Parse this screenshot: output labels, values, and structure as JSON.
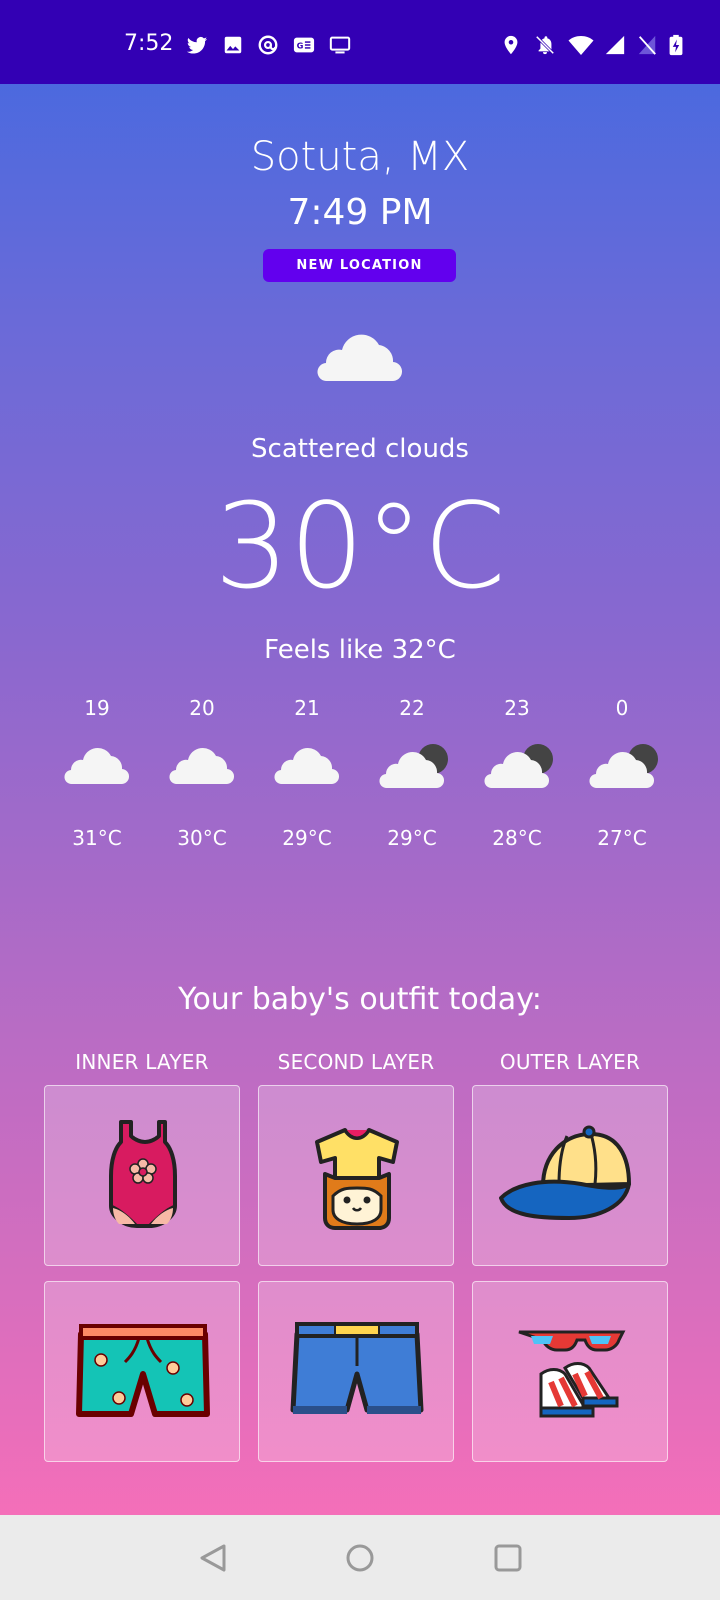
{
  "status_bar": {
    "time": "7:52",
    "left_icons": [
      "twitter-icon",
      "image-icon",
      "at-sign-icon",
      "translate-icon",
      "monitor-icon"
    ],
    "right_icons": [
      "location-icon",
      "notifications-off-icon",
      "wifi-icon",
      "signal-icon",
      "no-sim-icon",
      "battery-charging-icon"
    ]
  },
  "header": {
    "city": "Sotuta, MX",
    "time": "7:49 PM",
    "new_location_label": "NEW LOCATION"
  },
  "current": {
    "icon": "cloud-icon",
    "description": "Scattered clouds",
    "temperature": "30°C",
    "feels_like": "Feels like 32°C"
  },
  "hourly": [
    {
      "hour": "19",
      "temp": "31°C",
      "icon": "cloud-icon"
    },
    {
      "hour": "20",
      "temp": "30°C",
      "icon": "cloud-icon"
    },
    {
      "hour": "21",
      "temp": "29°C",
      "icon": "cloud-icon"
    },
    {
      "hour": "22",
      "temp": "29°C",
      "icon": "cloud-night-icon"
    },
    {
      "hour": "23",
      "temp": "28°C",
      "icon": "cloud-night-icon"
    },
    {
      "hour": "0",
      "temp": "27°C",
      "icon": "cloud-night-icon"
    }
  ],
  "outfit": {
    "title": "Your baby's outfit today:",
    "layers": [
      {
        "label": "INNER LAYER",
        "items": [
          "bodysuit-icon",
          "swim-shorts-icon"
        ]
      },
      {
        "label": "SECOND LAYER",
        "items": [
          "tshirt-icon",
          "denim-shorts-icon"
        ]
      },
      {
        "label": "OUTER LAYER",
        "items": [
          "cap-icon",
          "sunglasses-sandals-icon"
        ]
      }
    ]
  },
  "nav_bar": {
    "buttons": [
      "back-icon",
      "home-icon",
      "recents-icon"
    ]
  },
  "colors": {
    "status_bar": "#3300b4",
    "button": "#6200ee",
    "gradient_top": "#4169e1",
    "gradient_bottom": "#ff6fb7",
    "nav_bar": "#ebebeb"
  }
}
